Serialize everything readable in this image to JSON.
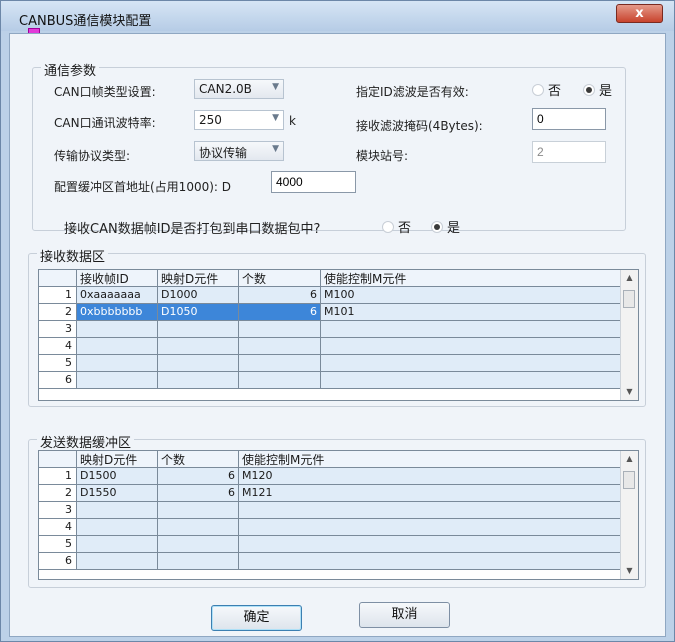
{
  "window": {
    "title": "CANBUS通信模块配置",
    "close_label": "x"
  },
  "comm": {
    "group_label": "通信参数",
    "frame_type_label": "CAN口帧类型设置:",
    "frame_type_value": "CAN2.0B",
    "baud_label": "CAN口通讯波特率:",
    "baud_value": "250",
    "baud_unit": "k",
    "protocol_label": "传输协议类型:",
    "protocol_value": "协议传输",
    "filter_valid_label": "指定ID滤波是否有效:",
    "filter_no": "否",
    "filter_yes": "是",
    "filter_selected": "yes",
    "mask_label": "接收滤波掩码(4Bytes):",
    "mask_value": "0",
    "station_label": "模块站号:",
    "station_value": "2",
    "buffer_label": "配置缓冲区首地址(占用1000): D",
    "buffer_value": "4000"
  },
  "pack": {
    "question": "接收CAN数据帧ID是否打包到串口数据包中?",
    "no": "否",
    "yes": "是",
    "selected": "yes"
  },
  "recv": {
    "group_label": "接收数据区",
    "columns": [
      "接收帧ID",
      "映射D元件",
      "个数",
      "使能控制M元件"
    ],
    "rows": [
      {
        "n": "1",
        "id": "0xaaaaaaa",
        "d": "D1000",
        "count": "6",
        "m": "M100"
      },
      {
        "n": "2",
        "id": "0xbbbbbbb",
        "d": "D1050",
        "count": "6",
        "m": "M101"
      },
      {
        "n": "3",
        "id": "",
        "d": "",
        "count": "",
        "m": ""
      },
      {
        "n": "4",
        "id": "",
        "d": "",
        "count": "",
        "m": ""
      },
      {
        "n": "5",
        "id": "",
        "d": "",
        "count": "",
        "m": ""
      },
      {
        "n": "6",
        "id": "",
        "d": "",
        "count": "",
        "m": ""
      }
    ],
    "selected_row": 2
  },
  "send": {
    "group_label": "发送数据缓冲区",
    "columns": [
      "映射D元件",
      "个数",
      "使能控制M元件"
    ],
    "rows": [
      {
        "n": "1",
        "d": "D1500",
        "count": "6",
        "m": "M120"
      },
      {
        "n": "2",
        "d": "D1550",
        "count": "6",
        "m": "M121"
      },
      {
        "n": "3",
        "d": "",
        "count": "",
        "m": ""
      },
      {
        "n": "4",
        "d": "",
        "count": "",
        "m": ""
      },
      {
        "n": "5",
        "d": "",
        "count": "",
        "m": ""
      },
      {
        "n": "6",
        "d": "",
        "count": "",
        "m": ""
      }
    ]
  },
  "buttons": {
    "ok": "确定",
    "cancel": "取消"
  },
  "colors": {
    "selection": "#3d86d9",
    "title_gradient_top": "#d6e5f5",
    "close_button": "#c8432d"
  }
}
